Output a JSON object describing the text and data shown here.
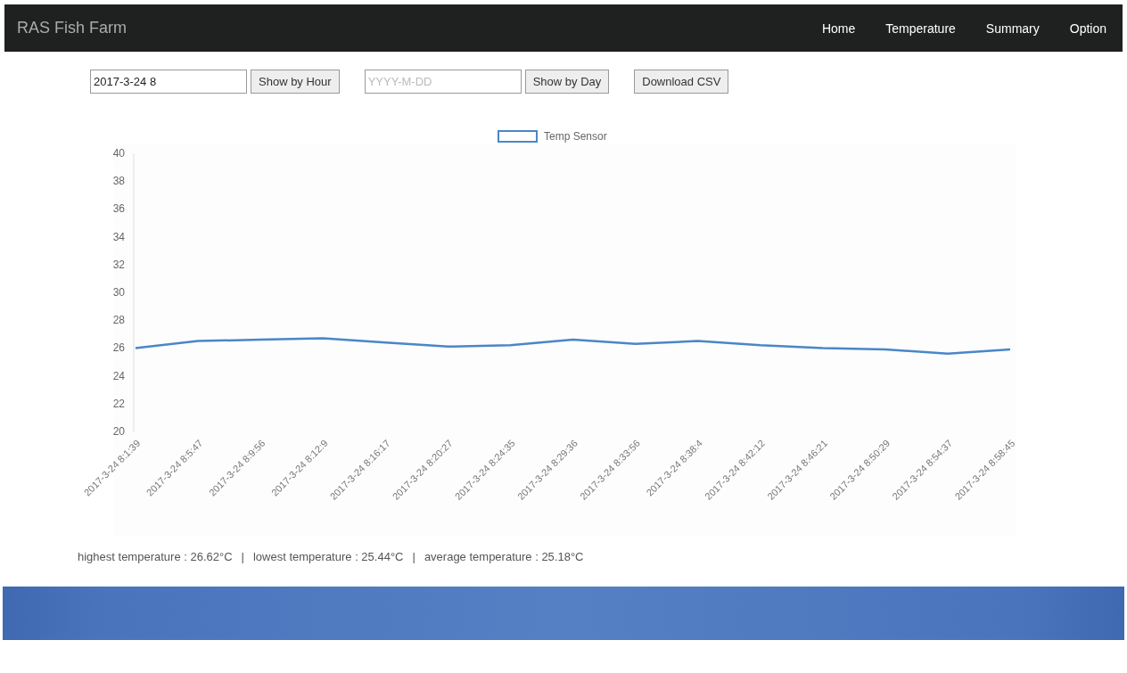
{
  "navbar": {
    "brand": "RAS Fish Farm",
    "links": [
      {
        "label": "Home"
      },
      {
        "label": "Temperature"
      },
      {
        "label": "Summary"
      },
      {
        "label": "Option"
      }
    ]
  },
  "controls": [
    {
      "kind": "field",
      "value": "2017-3-24 8"
    },
    {
      "kind": "button",
      "label": "Show by Hour"
    },
    {
      "kind": "field",
      "placeholder": "YYYY-M-DD"
    },
    {
      "kind": "button",
      "label": "Show by Day"
    },
    {
      "kind": "button",
      "label": "Download CSV"
    }
  ],
  "chart": {
    "chart_data": {
      "type": "line",
      "categories": [
        "2017-3-24 8:1:39",
        "2017-3-24 8:5:47",
        "2017-3-24 8:9:56",
        "2017-3-24 8:12:9",
        "2017-3-24 8:16:17",
        "2017-3-24 8:20:27",
        "2017-3-24 8:24:35",
        "2017-3-24 8:29:36",
        "2017-3-24 8:33:56",
        "2017-3-24 8:38:4",
        "2017-3-24 8:42:12",
        "2017-3-24 8:46:21",
        "2017-3-24 8:50:29",
        "2017-3-24 8:54:37",
        "2017-3-24 8:58:45"
      ],
      "series": [
        {
          "name": "Temp Sensor",
          "color": "#4a86c8",
          "values": [
            26.0,
            26.5,
            26.6,
            26.7,
            26.4,
            26.1,
            26.2,
            26.6,
            26.3,
            26.5,
            26.2,
            26.0,
            25.9,
            25.6,
            25.9
          ]
        }
      ],
      "ylim": [
        20,
        40
      ],
      "yticks": [
        20,
        22,
        24,
        26,
        28,
        30,
        32,
        34,
        36,
        38,
        40
      ]
    }
  },
  "stats": {
    "items": [
      "highest temperature : 26.62°C",
      "lowest temperature : 25.44°C",
      "average temperature : 25.18°C"
    ],
    "separator": "|"
  }
}
